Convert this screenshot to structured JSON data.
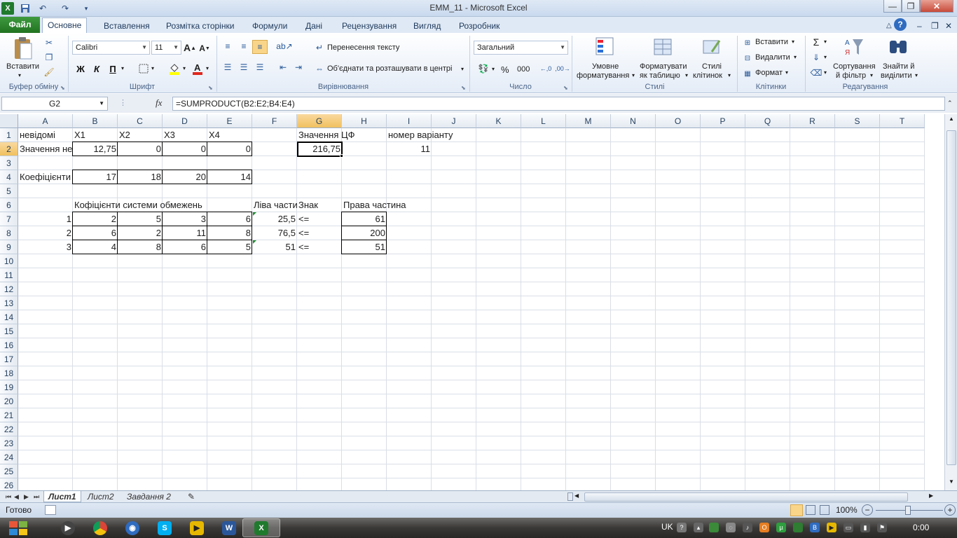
{
  "window": {
    "title": "EMM_11  -  Microsoft Excel"
  },
  "tabs": {
    "file": "Файл",
    "home": "Основне",
    "insert": "Вставлення",
    "layout": "Розмітка сторінки",
    "formulas": "Формули",
    "data": "Дані",
    "review": "Рецензування",
    "view": "Вигляд",
    "developer": "Розробник"
  },
  "ribbon": {
    "paste": "Вставити",
    "clipboard_label": "Буфер обміну",
    "font_name": "Calibri",
    "font_size": "11",
    "bold": "Ж",
    "italic": "К",
    "underline": "П",
    "font_label": "Шрифт",
    "wrap_text": "Перенесення тексту",
    "merge_center": "Об'єднати та розташувати в центрі",
    "alignment_label": "Вирівнювання",
    "number_format": "Загальний",
    "percent": "%",
    "thousands": "000",
    "number_label": "Число",
    "cond_format_1": "Умовне",
    "cond_format_2": "форматування",
    "format_table_1": "Форматувати",
    "format_table_2": "як таблицю",
    "cell_styles_1": "Стилі",
    "cell_styles_2": "клітинок",
    "styles_label": "Стилі",
    "insert_cells": "Вставити",
    "delete_cells": "Видалити",
    "format_cells": "Формат",
    "cells_label": "Клітинки",
    "sort_filter_1": "Сортування",
    "sort_filter_2": "й фільтр",
    "find_select_1": "Знайти й",
    "find_select_2": "виділити",
    "editing_label": "Редагування"
  },
  "formula_bar": {
    "name_box": "G2",
    "fx": "fx",
    "formula": "=SUMPRODUCT(B2:E2;B4:E4)"
  },
  "columns": [
    "A",
    "B",
    "C",
    "D",
    "E",
    "F",
    "G",
    "H",
    "I",
    "J",
    "K",
    "L",
    "M",
    "N",
    "O",
    "P",
    "Q",
    "R",
    "S",
    "T"
  ],
  "rows": [
    "1",
    "2",
    "3",
    "4",
    "5",
    "6",
    "7",
    "8",
    "9",
    "10",
    "11",
    "12",
    "13",
    "14",
    "15",
    "16",
    "17",
    "18",
    "19",
    "20",
    "21",
    "22",
    "23",
    "24",
    "25",
    "26"
  ],
  "cells": {
    "A1": "невідомі",
    "B1": "X1",
    "C1": "X2",
    "D1": "X3",
    "E1": "X4",
    "G1": "Значення ЦФ",
    "I1": "номер варіанту",
    "A2": "Значення невідомих",
    "B2": "12,75",
    "C2": "0",
    "D2": "0",
    "E2": "0",
    "G2": "216,75",
    "I2": "11",
    "A4": "Коефіцієнти ЦФ",
    "B4": "17",
    "C4": "18",
    "D4": "20",
    "E4": "14",
    "B6": "Кофіцієнти системи обмежень",
    "F6": "Ліва частина",
    "G6": "Знак",
    "H6": "Права частина",
    "A7": "1",
    "B7": "2",
    "C7": "5",
    "D7": "3",
    "E7": "6",
    "F7": "25,5",
    "G7": "<=",
    "H7": "61",
    "A8": "2",
    "B8": "6",
    "C8": "2",
    "D8": "11",
    "E8": "8",
    "F8": "76,5",
    "G8": "<=",
    "H8": "200",
    "A9": "3",
    "B9": "4",
    "C9": "8",
    "D9": "6",
    "E9": "5",
    "F9": "51",
    "G9": "<=",
    "H9": "51"
  },
  "sheets": {
    "sheet1": "Лист1",
    "sheet2": "Лист2",
    "sheet3": "Завдання 2"
  },
  "status": {
    "ready": "Готово",
    "zoom": "100%"
  },
  "taskbar": {
    "lang": "UK",
    "time": "0:00"
  }
}
